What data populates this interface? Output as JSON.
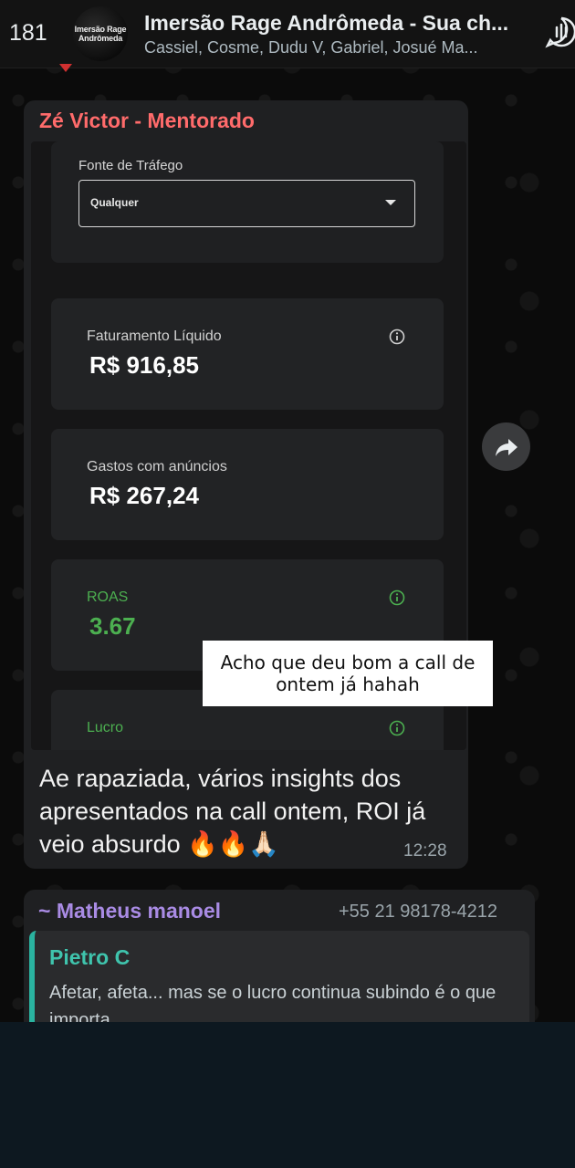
{
  "header": {
    "back_count": "181",
    "avatar_line1": "Imersão Rage",
    "avatar_line2": "Andrômeda",
    "title": "Imersão Rage Andrômeda - Sua ch...",
    "subtitle": "Cassiel, Cosme, Dudu V, Gabriel, Josué Ma..."
  },
  "message": {
    "sender": "Zé Victor - Mentorado",
    "text": "Ae rapaziada, vários insights dos apresentados na call ontem, ROI já veio absurdo 🔥🔥🙏🏻",
    "time": "12:28",
    "screenshot": {
      "fonte_label": "Fonte de Tráfego",
      "fonte_value": "Qualquer",
      "faturamento_label": "Faturamento Líquido",
      "faturamento_value": "R$ 916,85",
      "gastos_label": "Gastos com anúncios",
      "gastos_value": "R$ 267,24",
      "roas_label": "ROAS",
      "roas_value": "3.67",
      "lucro_label": "Lucro",
      "overlay_text": "Acho que deu bom a call de ontem já hahah",
      "green": "#4caf50"
    }
  },
  "message2": {
    "sender": "~ Matheus manoel",
    "phone": "+55 21 98178-4212",
    "quote_name": "Pietro C",
    "quote_text": "Afetar, afeta... mas se o lucro continua subindo é o que importa"
  },
  "colors": {
    "sender_red": "#ff6b6b",
    "sender_purple": "#a98be4",
    "quote_teal": "#3fc4ad"
  }
}
